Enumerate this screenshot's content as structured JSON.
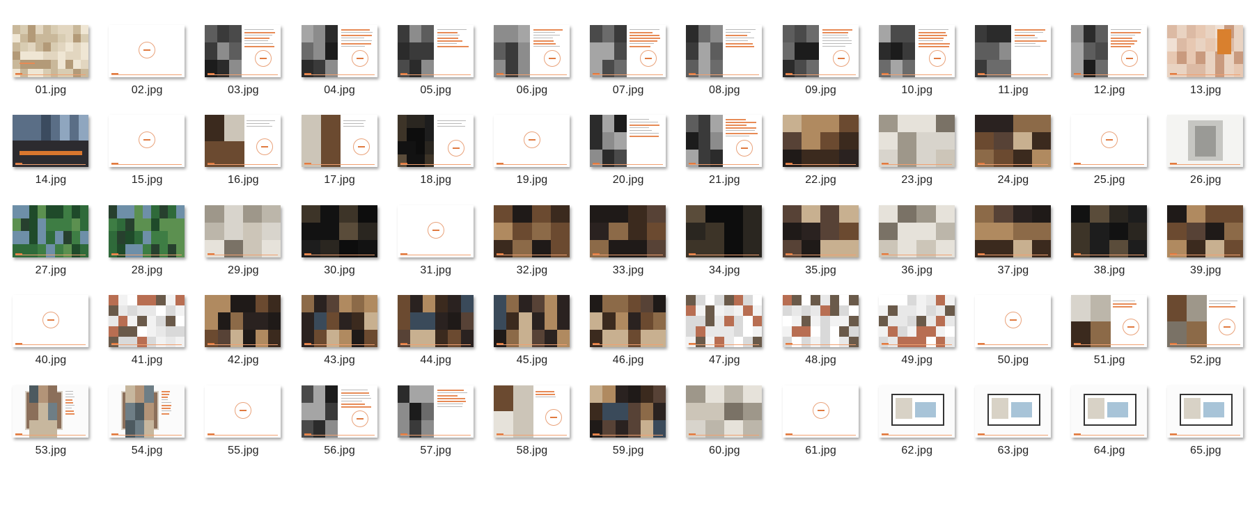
{
  "files": [
    {
      "name": "01.jpg",
      "kind": "map"
    },
    {
      "name": "02.jpg",
      "kind": "blank"
    },
    {
      "name": "03.jpg",
      "kind": "bwtext"
    },
    {
      "name": "04.jpg",
      "kind": "bwtext"
    },
    {
      "name": "05.jpg",
      "kind": "bwtext"
    },
    {
      "name": "06.jpg",
      "kind": "bwtext"
    },
    {
      "name": "07.jpg",
      "kind": "bwtext"
    },
    {
      "name": "08.jpg",
      "kind": "bwtext"
    },
    {
      "name": "09.jpg",
      "kind": "bwtext"
    },
    {
      "name": "10.jpg",
      "kind": "bwtext"
    },
    {
      "name": "11.jpg",
      "kind": "bwtext"
    },
    {
      "name": "12.jpg",
      "kind": "bwtext"
    },
    {
      "name": "13.jpg",
      "kind": "sepia"
    },
    {
      "name": "14.jpg",
      "kind": "city"
    },
    {
      "name": "15.jpg",
      "kind": "blank"
    },
    {
      "name": "16.jpg",
      "kind": "phototext"
    },
    {
      "name": "17.jpg",
      "kind": "phototext"
    },
    {
      "name": "18.jpg",
      "kind": "darktext"
    },
    {
      "name": "19.jpg",
      "kind": "blank"
    },
    {
      "name": "20.jpg",
      "kind": "bwtext"
    },
    {
      "name": "21.jpg",
      "kind": "bwtext"
    },
    {
      "name": "22.jpg",
      "kind": "interior"
    },
    {
      "name": "23.jpg",
      "kind": "interiorlight"
    },
    {
      "name": "24.jpg",
      "kind": "interior"
    },
    {
      "name": "25.jpg",
      "kind": "blank"
    },
    {
      "name": "26.jpg",
      "kind": "sketch"
    },
    {
      "name": "27.jpg",
      "kind": "green"
    },
    {
      "name": "28.jpg",
      "kind": "green"
    },
    {
      "name": "29.jpg",
      "kind": "interiorlight"
    },
    {
      "name": "30.jpg",
      "kind": "interiordark"
    },
    {
      "name": "31.jpg",
      "kind": "blank"
    },
    {
      "name": "32.jpg",
      "kind": "interior"
    },
    {
      "name": "33.jpg",
      "kind": "interior"
    },
    {
      "name": "34.jpg",
      "kind": "interiordark"
    },
    {
      "name": "35.jpg",
      "kind": "interior"
    },
    {
      "name": "36.jpg",
      "kind": "interiorlight"
    },
    {
      "name": "37.jpg",
      "kind": "interior"
    },
    {
      "name": "38.jpg",
      "kind": "interiordark"
    },
    {
      "name": "39.jpg",
      "kind": "interior"
    },
    {
      "name": "40.jpg",
      "kind": "blank"
    },
    {
      "name": "41.jpg",
      "kind": "plan"
    },
    {
      "name": "42.jpg",
      "kind": "render"
    },
    {
      "name": "43.jpg",
      "kind": "render"
    },
    {
      "name": "44.jpg",
      "kind": "render"
    },
    {
      "name": "45.jpg",
      "kind": "render"
    },
    {
      "name": "46.jpg",
      "kind": "render"
    },
    {
      "name": "47.jpg",
      "kind": "plan"
    },
    {
      "name": "48.jpg",
      "kind": "plan"
    },
    {
      "name": "49.jpg",
      "kind": "plan"
    },
    {
      "name": "50.jpg",
      "kind": "blank"
    },
    {
      "name": "51.jpg",
      "kind": "phototext"
    },
    {
      "name": "52.jpg",
      "kind": "phototext"
    },
    {
      "name": "53.jpg",
      "kind": "material"
    },
    {
      "name": "54.jpg",
      "kind": "material"
    },
    {
      "name": "55.jpg",
      "kind": "blank"
    },
    {
      "name": "56.jpg",
      "kind": "bwtext"
    },
    {
      "name": "57.jpg",
      "kind": "bwtext"
    },
    {
      "name": "58.jpg",
      "kind": "phototext"
    },
    {
      "name": "59.jpg",
      "kind": "render"
    },
    {
      "name": "60.jpg",
      "kind": "interiorlight"
    },
    {
      "name": "61.jpg",
      "kind": "blank"
    },
    {
      "name": "62.jpg",
      "kind": "floorplan"
    },
    {
      "name": "63.jpg",
      "kind": "floorplan"
    },
    {
      "name": "64.jpg",
      "kind": "floorplan"
    },
    {
      "name": "65.jpg",
      "kind": "floorplan"
    }
  ],
  "colors": {
    "accent": "#e07a40",
    "label": "#222222"
  }
}
